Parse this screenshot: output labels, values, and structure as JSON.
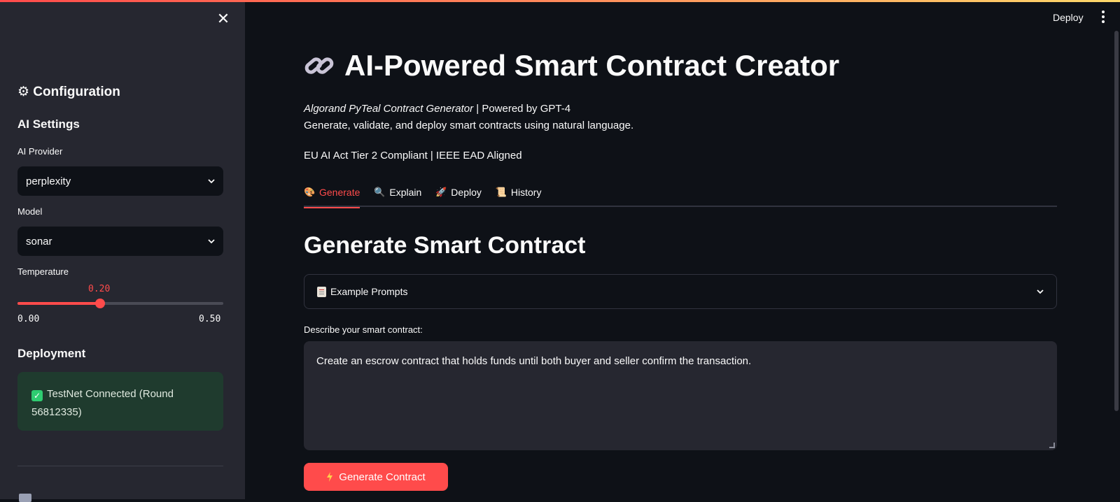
{
  "header": {
    "deploy_label": "Deploy"
  },
  "sidebar": {
    "title": "⚙ Configuration",
    "ai_settings_heading": "AI Settings",
    "provider": {
      "label": "AI Provider",
      "value": "perplexity"
    },
    "model": {
      "label": "Model",
      "value": "sonar"
    },
    "temperature": {
      "label": "Temperature",
      "value": "0.20",
      "min": "0.00",
      "max": "0.50",
      "fraction": 0.4
    },
    "deployment_heading": "Deployment",
    "status": "TestNet Connected (Round 56812335)"
  },
  "main": {
    "title": "AI-Powered Smart Contract Creator",
    "subtitle_italic": "Algorand PyTeal Contract Generator",
    "subtitle_rest": " | Powered by GPT-4",
    "subtitle_line2": "Generate, validate, and deploy smart contracts using natural language.",
    "compliance": "EU AI Act Tier 2 Compliant | IEEE EAD Aligned",
    "tabs": [
      {
        "label": "Generate",
        "icon": "palette-icon"
      },
      {
        "label": "Explain",
        "icon": "magnifier-icon"
      },
      {
        "label": "Deploy",
        "icon": "rocket-icon"
      },
      {
        "label": "History",
        "icon": "scroll-icon"
      }
    ],
    "section_title": "Generate Smart Contract",
    "expander_label": "Example Prompts",
    "textarea_label": "Describe your smart contract:",
    "textarea_value": "Create an escrow contract that holds funds until both buyer and seller confirm the transaction.",
    "generate_button": "Generate Contract"
  },
  "colors": {
    "accent": "#ff4b4b",
    "success_bg": "#1f3b2e",
    "sidebar_bg": "#262730",
    "main_bg": "#0e1117"
  }
}
